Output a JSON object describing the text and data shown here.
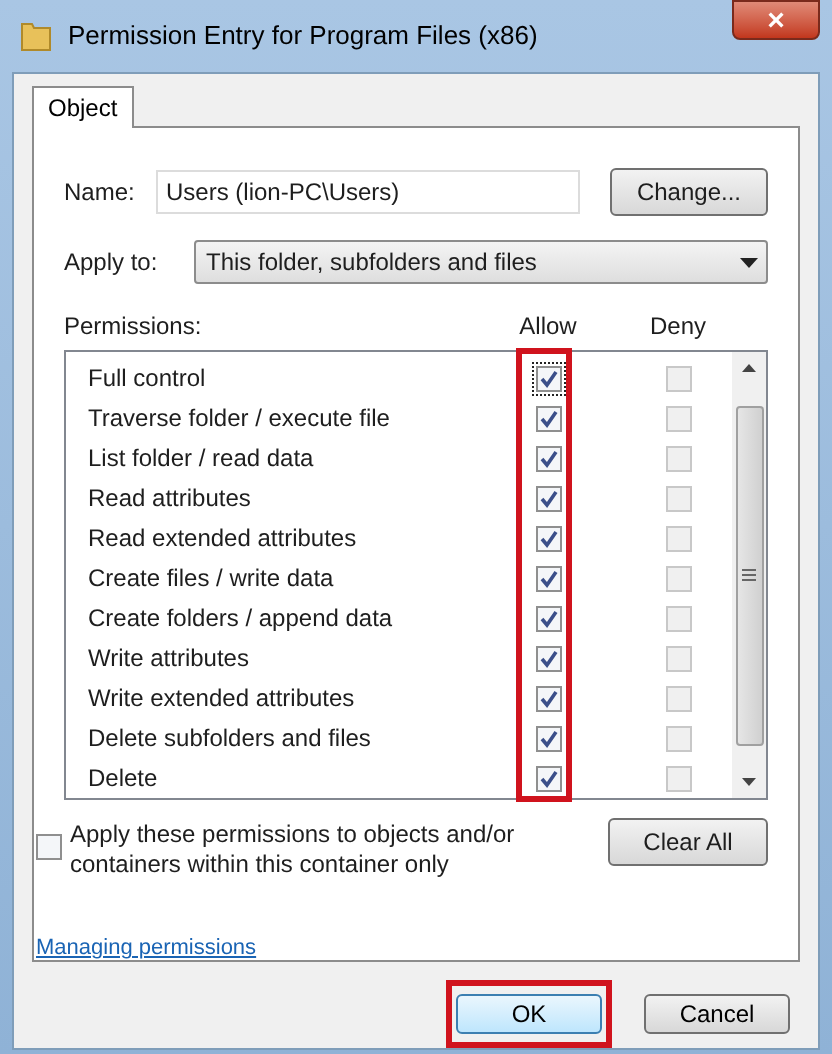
{
  "window": {
    "title": "Permission Entry for Program Files (x86)",
    "close_label": "×"
  },
  "tabs": [
    {
      "label": "Object",
      "selected": true
    }
  ],
  "name_field": {
    "label": "Name:",
    "value": "Users (lion-PC\\Users)"
  },
  "change_button": "Change...",
  "apply_to": {
    "label": "Apply to:",
    "value": "This folder, subfolders and files"
  },
  "permissions": {
    "label": "Permissions:",
    "allow_header": "Allow",
    "deny_header": "Deny",
    "allow_highlighted": true,
    "rows": [
      {
        "name": "Full control",
        "allow": true,
        "deny": false,
        "focused": true
      },
      {
        "name": "Traverse folder / execute file",
        "allow": true,
        "deny": false,
        "focused": false
      },
      {
        "name": "List folder / read data",
        "allow": true,
        "deny": false,
        "focused": false
      },
      {
        "name": "Read attributes",
        "allow": true,
        "deny": false,
        "focused": false
      },
      {
        "name": "Read extended attributes",
        "allow": true,
        "deny": false,
        "focused": false
      },
      {
        "name": "Create files / write data",
        "allow": true,
        "deny": false,
        "focused": false
      },
      {
        "name": "Create folders / append data",
        "allow": true,
        "deny": false,
        "focused": false
      },
      {
        "name": "Write attributes",
        "allow": true,
        "deny": false,
        "focused": false
      },
      {
        "name": "Write extended attributes",
        "allow": true,
        "deny": false,
        "focused": false
      },
      {
        "name": "Delete subfolders and files",
        "allow": true,
        "deny": false,
        "focused": false
      },
      {
        "name": "Delete",
        "allow": true,
        "deny": false,
        "focused": false
      }
    ]
  },
  "apply_only": {
    "label": "Apply these permissions to objects and/or containers within this container only",
    "checked": false
  },
  "clear_all_button": "Clear All",
  "help_link": "Managing permissions",
  "buttons": [
    {
      "label": "OK",
      "highlighted": true
    },
    {
      "label": "Cancel",
      "highlighted": false
    }
  ]
}
